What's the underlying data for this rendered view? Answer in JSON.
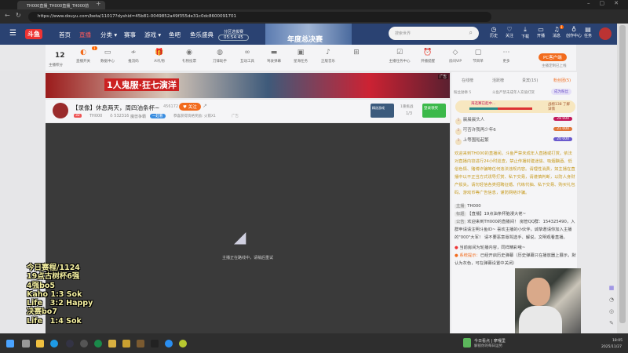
{
  "browser": {
    "tab_title": "TH000直播_TH000直播_TH000前",
    "url": "https://www.douyu.com/beta/11017?dyshid=45b81-0049852a49f355de31c0dc8600091701"
  },
  "header": {
    "logo": "斗鱼",
    "nav": [
      "首页",
      "直播",
      "分类 ▾",
      "赛事",
      "游戏 ▾",
      "鱼吧",
      "鱼乐盛典"
    ],
    "countdown_label": "分区选拔赛",
    "countdown": "05:54:45",
    "banner_text": "年度总决赛",
    "search_placeholder": "搜索世界",
    "icons": [
      {
        "icon": "history-icon",
        "label": "历史"
      },
      {
        "icon": "heart-icon",
        "label": "关注"
      },
      {
        "icon": "download-icon",
        "label": "下载"
      },
      {
        "icon": "broadcast-icon",
        "label": "开播"
      },
      {
        "icon": "bell-icon",
        "label": "消息"
      },
      {
        "icon": "bulb-icon",
        "label": "创作中心"
      },
      {
        "icon": "task-icon",
        "label": "任务"
      }
    ],
    "msg_badge": "1"
  },
  "toolbar": {
    "score": "12",
    "score_label": "主播积分",
    "items": [
      {
        "icon": "toggle-icon",
        "label": "直播开关"
      },
      {
        "icon": "monitor-icon",
        "label": "数据中心"
      },
      {
        "icon": "wave-icon",
        "label": "推流码"
      },
      {
        "icon": "ai-gift-icon",
        "label": "AI礼物"
      },
      {
        "icon": "gift-vote-icon",
        "label": "礼物投票"
      },
      {
        "icon": "knife-icon",
        "label": "刀锋助手"
      },
      {
        "icon": "interact-icon",
        "label": "互动工具"
      },
      {
        "icon": "danmu-icon",
        "label": "驾驶弹幕"
      },
      {
        "icon": "ad-icon",
        "label": "星海任务"
      },
      {
        "icon": "music-icon",
        "label": "正版音乐"
      },
      {
        "icon": "gift-icon",
        "label": ""
      },
      {
        "icon": "checklist-icon",
        "label": "主播任务中心"
      },
      {
        "icon": "alarm-icon",
        "label": "开播提醒"
      },
      {
        "icon": "diamond-icon",
        "label": "房间VIP"
      },
      {
        "icon": "program-icon",
        "label": "节目单"
      },
      {
        "icon": "more-icon",
        "label": "更多"
      }
    ],
    "pc_client": "PC客户端",
    "pc_note": "主播定制已上线",
    "live_badge": "1"
  },
  "ad": {
    "slogan": "1人鬼服·狂七演洋",
    "label": "广告"
  },
  "stream": {
    "title": "【录像】休息两天，周四油条杯~",
    "hot": "456172",
    "follow": "关注",
    "level": "32",
    "name": "TH000",
    "fans": "532316",
    "category": "魔兽争霸",
    "tag": "一起看",
    "reward": "恭喜获得资格奖励: 火箭X1",
    "ad": "广告",
    "game_badge": "精选游戏",
    "pager_title": "1重挑战",
    "pager": "1/3",
    "promo": "登录领奖"
  },
  "video": {
    "status": "主播正在路线中，请稍后重试"
  },
  "overlay": [
    "今日赛程/1124",
    "19点古树杯6强",
    "4强bo5",
    "Kaho 1:3 Sok",
    "Life   3:2 Happy",
    "决赛bo7",
    "Life   1:4 Sok"
  ],
  "right": {
    "tabs": [
      "在线榜",
      "活跃榜",
      "贵宾(15)",
      "粉丝团(5)"
    ],
    "fan_row": "粉丝勋章 5",
    "fan_note": "斗鱼严禁未成年人充值打赏",
    "fan_btn": "成为粉丝",
    "banner_text": "海选赛已起中...",
    "banner_side": "战榜138 了解详情",
    "ranks": [
      {
        "n": "1",
        "name": "晨晨晨头人",
        "lv": "28",
        "v": "000"
      },
      {
        "n": "2",
        "name": "可否许我再少年6",
        "lv": "21",
        "v": "000"
      },
      {
        "n": "3",
        "name": "上等围船起繁",
        "lv": "20",
        "v": "000"
      }
    ],
    "notice": "欢迎来到TH000的直播间。斗鱼严禁未成年人直播或打赏。依法对直播内容进行24小时巡查，禁止传播封建迷信、吸烟酗酒、低俗色情、赌博诈骗等任何违法违规内容。请理性消费，如主播在直播中以不正当方式诱导打赏、私下交易，请谨慎判断，以防人身财产损失。请勿轻信各类招聘征婚、代练代抽、私下交易、购买礼包码、游戏币等广告信息，谨防网络诈骗。",
    "chat": [
      {
        "tag": "主播",
        "text": "TH000"
      },
      {
        "tag": "标题",
        "text": "【直播】19点油条杯脑漫大佬~"
      },
      {
        "tag": "公告",
        "text": "欢迎来到TH000的直播间！ 房管QQ群：154325490，入群申请请注明斗鱼ID~ 喜欢主播的小伙伴，诚挚邀请你加入主播的\"000\"大军！ 请不要恶意辱骂选手、解说，文明观看直播。"
      }
    ],
    "loop_note": "当前房间为轮播内容，同样精彩哦~",
    "sys_label": "系统提示：",
    "sys_text": "已经开启历史弹幕（历史弹幕只在播放器上展示，默认为灰色，可在弹幕设置中关闭）"
  },
  "taskbar": {
    "news_title": "今日看点 | 摩嘎里",
    "news_sub": "解锁你的每日运势",
    "time": "18:05",
    "date": "2025/11/27"
  },
  "colors": {
    "header": "#2a4272",
    "accent": "#f26b1d",
    "notice": "#c79a1e"
  }
}
